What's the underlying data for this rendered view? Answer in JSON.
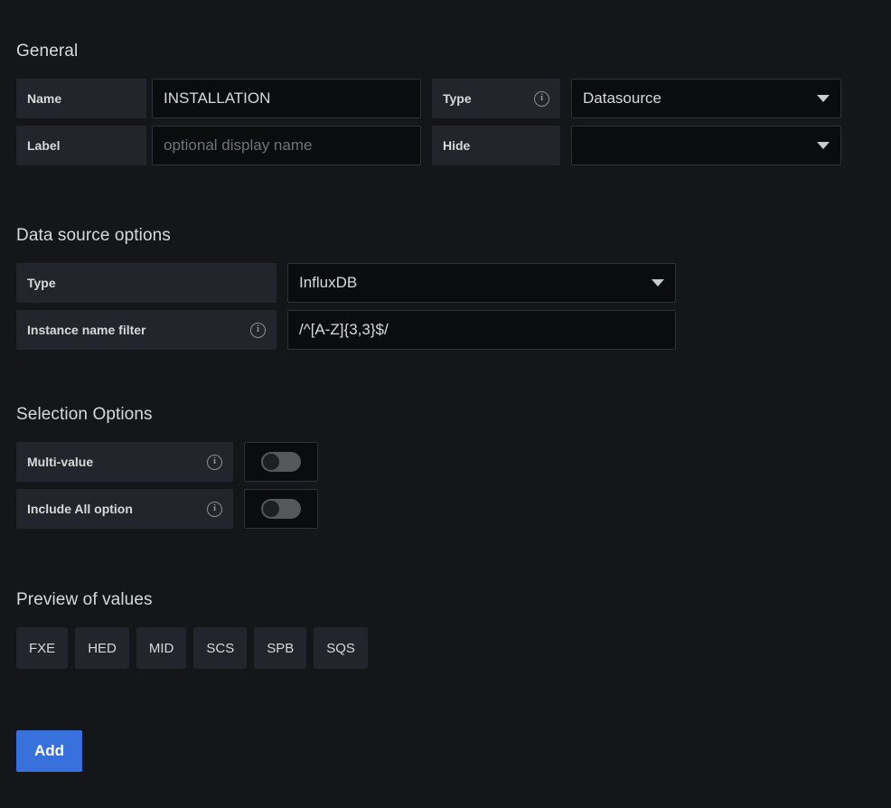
{
  "sections": {
    "general": {
      "title": "General",
      "name_label": "Name",
      "name_value": "INSTALLATION",
      "label_label": "Label",
      "label_placeholder": "optional display name",
      "type_label": "Type",
      "type_info_icon": "info-circle-icon",
      "type_value": "Datasource",
      "hide_label": "Hide",
      "hide_value": ""
    },
    "datasource_options": {
      "title": "Data source options",
      "type_label": "Type",
      "type_value": "InfluxDB",
      "instance_filter_label": "Instance name filter",
      "instance_filter_info_icon": "info-circle-icon",
      "instance_filter_value": "/^[A-Z]{3,3}$/"
    },
    "selection_options": {
      "title": "Selection Options",
      "multi_value_label": "Multi-value",
      "multi_value_info_icon": "info-circle-icon",
      "multi_value_state": "off",
      "include_all_label": "Include All option",
      "include_all_info_icon": "info-circle-icon",
      "include_all_state": "off"
    },
    "preview": {
      "title": "Preview of values",
      "values": [
        "FXE",
        "HED",
        "MID",
        "SCS",
        "SPB",
        "SQS"
      ]
    },
    "actions": {
      "add_label": "Add"
    }
  },
  "colors": {
    "background": "#141619",
    "panel": "#22252b",
    "input_bg": "#0b0c0e",
    "border": "#2c3235",
    "text": "#d8d9da",
    "muted_text": "#6e7378",
    "accent": "#3871dc"
  }
}
